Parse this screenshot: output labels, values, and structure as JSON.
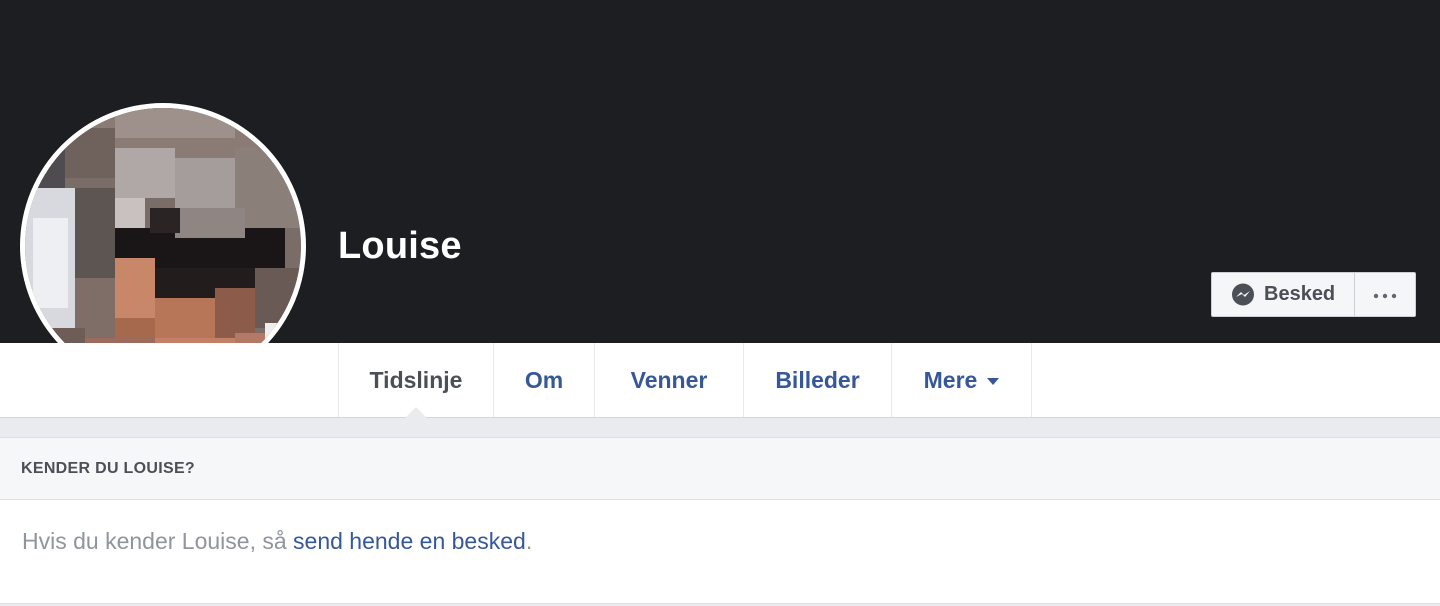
{
  "profile": {
    "name": "Louise",
    "avatar_description": "pixelated-profile-photo"
  },
  "actions": {
    "message_label": "Besked",
    "message_icon": "messenger-icon",
    "more_icon": "ellipsis-icon"
  },
  "tabs": [
    {
      "label": "Tidslinje",
      "active": true
    },
    {
      "label": "Om",
      "active": false
    },
    {
      "label": "Venner",
      "active": false
    },
    {
      "label": "Billeder",
      "active": false
    },
    {
      "label": "Mere",
      "active": false,
      "dropdown": true
    }
  ],
  "card": {
    "header": "KENDER DU LOUISE?",
    "body_prefix": "Hvis du kender Louise, så ",
    "body_link": "send hende en besked",
    "body_suffix": "."
  },
  "colors": {
    "cover": "#1d1e22",
    "link": "#365899",
    "background": "#e9ebee"
  }
}
